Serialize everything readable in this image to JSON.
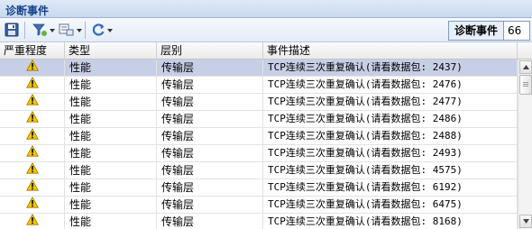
{
  "panel": {
    "title": "诊断事件"
  },
  "toolbar": {
    "count_label": "诊断事件",
    "count_value": "66",
    "icons": [
      "save-icon",
      "filter-icon",
      "view-icon",
      "refresh-icon"
    ]
  },
  "table": {
    "columns": [
      "严重程度",
      "类型",
      "层别",
      "事件描述"
    ],
    "rows": [
      {
        "severity": "warning",
        "type": "性能",
        "layer": "传输层",
        "description": "TCP连续三次重复确认(请看数据包: 2437)"
      },
      {
        "severity": "warning",
        "type": "性能",
        "layer": "传输层",
        "description": "TCP连续三次重复确认(请看数据包: 2476)"
      },
      {
        "severity": "warning",
        "type": "性能",
        "layer": "传输层",
        "description": "TCP连续三次重复确认(请看数据包: 2477)"
      },
      {
        "severity": "warning",
        "type": "性能",
        "layer": "传输层",
        "description": "TCP连续三次重复确认(请看数据包: 2486)"
      },
      {
        "severity": "warning",
        "type": "性能",
        "layer": "传输层",
        "description": "TCP连续三次重复确认(请看数据包: 2488)"
      },
      {
        "severity": "warning",
        "type": "性能",
        "layer": "传输层",
        "description": "TCP连续三次重复确认(请看数据包: 2493)"
      },
      {
        "severity": "warning",
        "type": "性能",
        "layer": "传输层",
        "description": "TCP连续三次重复确认(请看数据包: 4575)"
      },
      {
        "severity": "warning",
        "type": "性能",
        "layer": "传输层",
        "description": "TCP连续三次重复确认(请看数据包: 6192)"
      },
      {
        "severity": "warning",
        "type": "性能",
        "layer": "传输层",
        "description": "TCP连续三次重复确认(请看数据包: 6475)"
      },
      {
        "severity": "warning",
        "type": "性能",
        "layer": "传输层",
        "description": "TCP连续三次重复确认(请看数据包: 8168)"
      }
    ],
    "selected_row": 0
  },
  "colors": {
    "title_text": "#15428b",
    "selected_row": "#c7cfe6",
    "warning_icon": "#f5c400"
  }
}
